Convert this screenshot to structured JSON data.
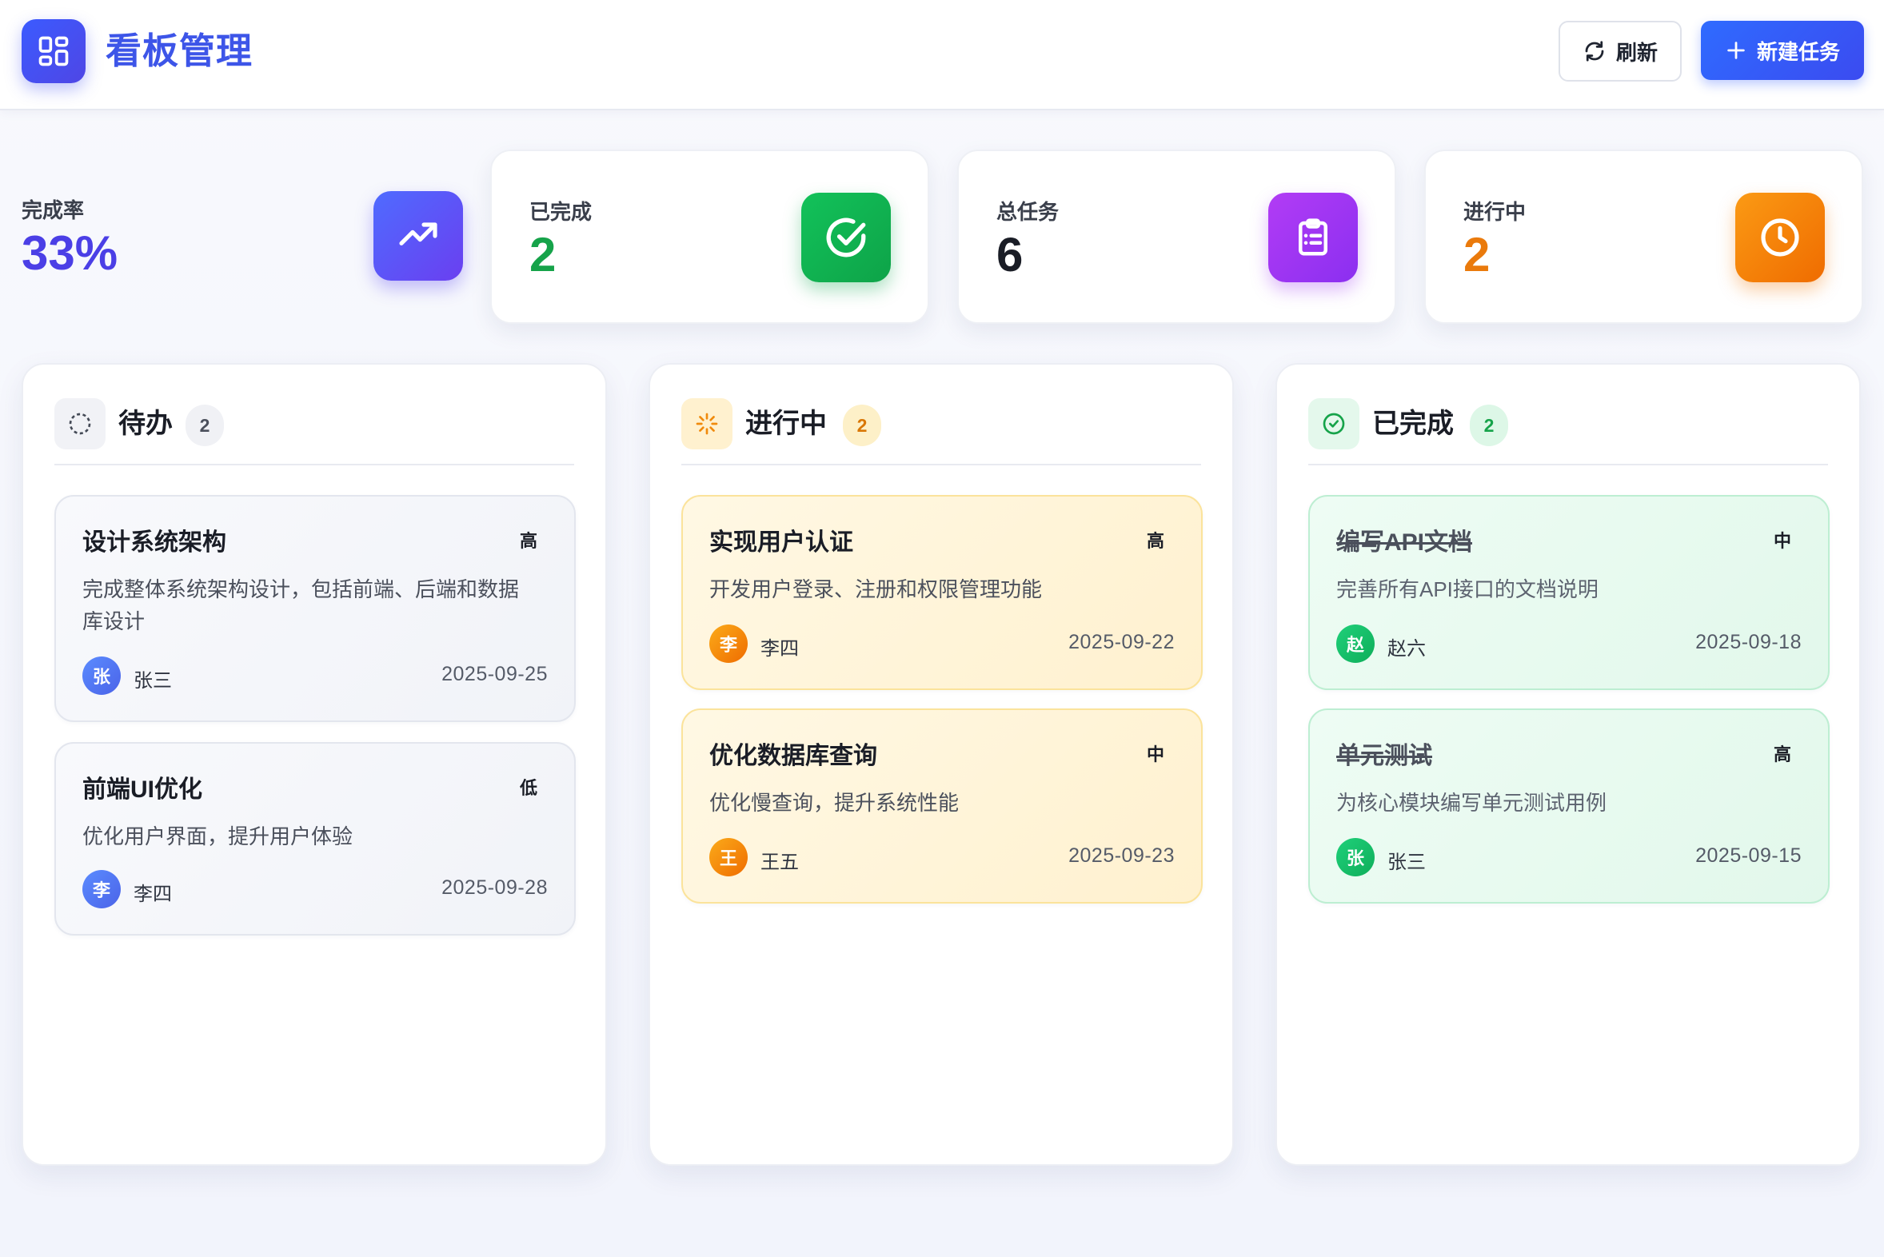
{
  "header": {
    "title": "看板管理",
    "refresh_label": "刷新",
    "new_task_label": "新建任务"
  },
  "stats": {
    "completion_rate": {
      "label": "完成率",
      "value": "33%",
      "color": "#4b3fe6"
    },
    "completed": {
      "label": "已完成",
      "value": "2",
      "color": "#16a34a"
    },
    "total": {
      "label": "总任务",
      "value": "6",
      "color": "#1a1d26"
    },
    "in_progress": {
      "label": "进行中",
      "value": "2",
      "color": "#ea7a0c"
    }
  },
  "columns": {
    "todo": {
      "title": "待办",
      "count": "2",
      "tasks": [
        {
          "title": "设计系统架构",
          "priority": "高",
          "description": "完成整体系统架构设计，包括前端、后端和数据库设计",
          "avatar": "张",
          "assignee": "张三",
          "due": "2025-09-25"
        },
        {
          "title": "前端UI优化",
          "priority": "低",
          "description": "优化用户界面，提升用户体验",
          "avatar": "李",
          "assignee": "李四",
          "due": "2025-09-28"
        }
      ]
    },
    "doing": {
      "title": "进行中",
      "count": "2",
      "tasks": [
        {
          "title": "实现用户认证",
          "priority": "高",
          "description": "开发用户登录、注册和权限管理功能",
          "avatar": "李",
          "assignee": "李四",
          "due": "2025-09-22"
        },
        {
          "title": "优化数据库查询",
          "priority": "中",
          "description": "优化慢查询，提升系统性能",
          "avatar": "王",
          "assignee": "王五",
          "due": "2025-09-23"
        }
      ]
    },
    "done": {
      "title": "已完成",
      "count": "2",
      "tasks": [
        {
          "title": "编写API文档",
          "priority": "中",
          "description": "完善所有API接口的文档说明",
          "avatar": "赵",
          "assignee": "赵六",
          "due": "2025-09-18"
        },
        {
          "title": "单元测试",
          "priority": "高",
          "description": "为核心模块编写单元测试用例",
          "avatar": "张",
          "assignee": "张三",
          "due": "2025-09-15"
        }
      ]
    }
  },
  "colors": {
    "brand": "#3d55e8",
    "todo_avatar": "#5b7cf6",
    "doing_avatar": "#f59e0b",
    "done_avatar": "#16c26b"
  },
  "icons": {
    "logo": "dashboard-grid-icon",
    "refresh": "refresh-icon",
    "new_task": "plus-icon",
    "completion_rate": "trending-up-icon",
    "completed": "check-circle-icon",
    "total": "clipboard-list-icon",
    "in_progress": "clock-icon",
    "todo": "dashed-circle-icon",
    "doing": "loader-icon",
    "done": "check-circle-icon"
  }
}
